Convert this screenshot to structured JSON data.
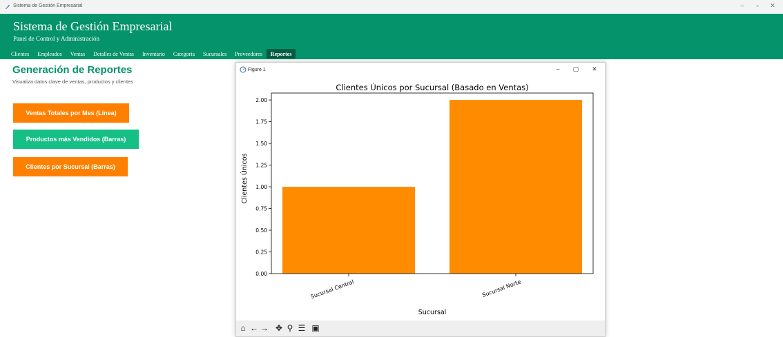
{
  "window": {
    "title": "Sistema de Gestión Empresarial",
    "minimize_icon": "minimize-icon",
    "maximize_icon": "maximize-icon",
    "close_icon": "close-icon"
  },
  "header": {
    "title": "Sistema de Gestión Empresarial",
    "subtitle": "Panel de Control y Administración"
  },
  "nav": {
    "items": [
      "Clientes",
      "Empleados",
      "Ventas",
      "Detalles de Ventas",
      "Inventario",
      "Categoría",
      "Sucursales",
      "Proveedores",
      "Reportes"
    ],
    "active": "Reportes"
  },
  "reports": {
    "title": "Generación de Reportes",
    "subtitle": "Visualiza datos clave de ventas, productos y clientes",
    "buttons": [
      "Ventas Totales por Mes (Línea)",
      "Productos más Vendidos (Barras)",
      "Clientes por Sucursal (Barras)"
    ]
  },
  "colors": {
    "accent": "#04936a",
    "button_orange": "#ff8000",
    "button_green": "#16bf85",
    "bar": "#ff8c00"
  },
  "figure_window": {
    "title": "Figure 1",
    "toolbar_icons": [
      "home-icon",
      "back-arrow-icon",
      "forward-arrow-icon",
      "pan-icon",
      "zoom-icon",
      "configure-icon",
      "save-icon"
    ]
  },
  "chart_data": {
    "type": "bar",
    "title": "Clientes Únicos por Sucursal (Basado en Ventas)",
    "xlabel": "Sucursal",
    "ylabel": "Clientes Únicos",
    "categories": [
      "Sucursal Central",
      "Sucursal Norte"
    ],
    "values": [
      1,
      2
    ],
    "ylim": [
      0,
      2.08
    ],
    "yticks": [
      "0.00",
      "0.25",
      "0.50",
      "0.75",
      "1.00",
      "1.25",
      "1.50",
      "1.75",
      "2.00"
    ],
    "grid": false,
    "bar_color": "#ff8c00"
  }
}
